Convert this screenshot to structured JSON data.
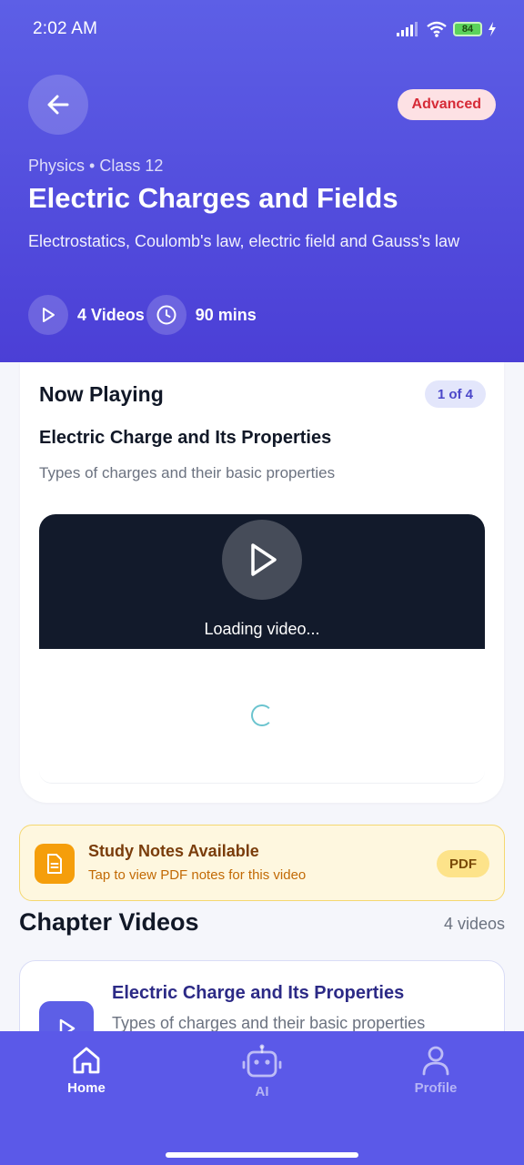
{
  "status_bar": {
    "time": "2:02 AM",
    "battery": "84"
  },
  "header": {
    "level_badge": "Advanced",
    "breadcrumb": "Physics • Class 12",
    "title": "Electric Charges and Fields",
    "subtitle": "Electrostatics, Coulomb's law, electric field and Gauss's law",
    "videos_meta": "4 Videos",
    "duration_meta": "90 mins"
  },
  "now_playing": {
    "heading": "Now Playing",
    "position": "1 of 4",
    "video_title": "Electric Charge and Its Properties",
    "video_desc": "Types of charges and their basic properties",
    "loading_text": "Loading video..."
  },
  "notes": {
    "title": "Study Notes Available",
    "subtitle": "Tap to view PDF notes for this video",
    "badge": "PDF"
  },
  "chapter_videos": {
    "heading": "Chapter Videos",
    "count": "4 videos",
    "items": [
      {
        "title": "Electric Charge and Its Properties",
        "desc": "Types of charges and their basic properties"
      }
    ]
  },
  "bottom_nav": {
    "items": [
      {
        "label": "Home",
        "icon": "home-icon",
        "active": true
      },
      {
        "label": "AI",
        "icon": "robot-icon",
        "active": false
      },
      {
        "label": "Profile",
        "icon": "user-icon",
        "active": false
      }
    ]
  },
  "colors": {
    "header": "#5d5fe6",
    "accent": "#4b47c9",
    "badge_red": "#d62b37",
    "notes_amber": "#f59e0b"
  }
}
